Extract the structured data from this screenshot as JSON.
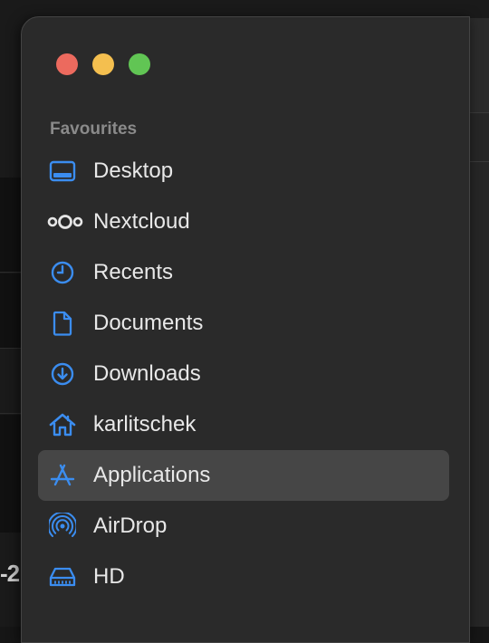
{
  "colors": {
    "accent": "#3b8df0",
    "close": "#ec6a5e",
    "minimize": "#f4bf4f",
    "zoom": "#61c554"
  },
  "background": {
    "fragment_text": "-2"
  },
  "sidebar": {
    "section_title": "Favourites",
    "items": [
      {
        "label": "Desktop",
        "icon": "desktop-icon",
        "selected": false
      },
      {
        "label": "Nextcloud",
        "icon": "nextcloud-icon",
        "selected": false
      },
      {
        "label": "Recents",
        "icon": "clock-icon",
        "selected": false
      },
      {
        "label": "Documents",
        "icon": "document-icon",
        "selected": false
      },
      {
        "label": "Downloads",
        "icon": "download-icon",
        "selected": false
      },
      {
        "label": "karlitschek",
        "icon": "home-icon",
        "selected": false
      },
      {
        "label": "Applications",
        "icon": "applications-icon",
        "selected": true
      },
      {
        "label": "AirDrop",
        "icon": "airdrop-icon",
        "selected": false
      },
      {
        "label": "HD",
        "icon": "drive-icon",
        "selected": false
      }
    ]
  }
}
